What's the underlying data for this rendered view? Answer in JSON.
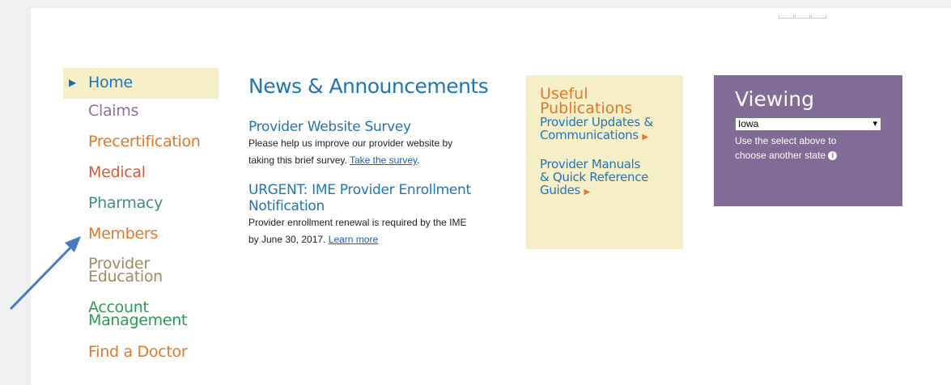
{
  "nav": {
    "items": [
      {
        "label": "Home",
        "active": true,
        "color": "#1f76b5"
      },
      {
        "label": "Claims",
        "color": "#8c6ea4"
      },
      {
        "label": "Precertification",
        "color": "#e0782c"
      },
      {
        "label": "Medical",
        "color": "#d9583a"
      },
      {
        "label": "Pharmacy",
        "color": "#3e8e86"
      },
      {
        "label": "Members",
        "color": "#e0782c"
      },
      {
        "label_line1": "Provider",
        "label_line2": "Education",
        "color": "#9b8d64"
      },
      {
        "label_line1": "Account",
        "label_line2": "Management",
        "color": "#2e9a52"
      },
      {
        "label": "Find a Doctor",
        "color": "#e0782c"
      }
    ]
  },
  "news": {
    "heading": "News & Announcements",
    "items": [
      {
        "title": "Provider Website Survey",
        "text_line1": "Please help us improve our provider website by",
        "text_line2": "taking this brief survey.",
        "link": "Take the survey",
        "after": "."
      },
      {
        "title_line1": "URGENT: IME Provider Enrollment",
        "title_line2": "Notification",
        "text_line1": "Provider enrollment renewal is required by the IME",
        "text_line2": "by June 30, 2017.",
        "link": "Learn more"
      }
    ]
  },
  "publications": {
    "title_line1": "Useful",
    "title_line2": "Publications",
    "links": [
      {
        "line1": "Provider Updates &",
        "line2": "Communications"
      },
      {
        "line1": "Provider Manuals",
        "line2": "& Quick Reference",
        "line3": "Guides"
      }
    ]
  },
  "viewing": {
    "title": "Viewing",
    "selected_state": "Iowa",
    "help_line1": "Use the select above to",
    "help_line2": "choose another state"
  },
  "colors": {
    "purple_panel": "#836b98",
    "yellow_panel": "#f7efc8",
    "link_blue": "#1f76b5",
    "arrow_blue": "#4a79c4"
  },
  "icons": [
    "triangle-right-icon",
    "chevron-down-icon",
    "info-icon",
    "pointer-arrow-icon"
  ]
}
